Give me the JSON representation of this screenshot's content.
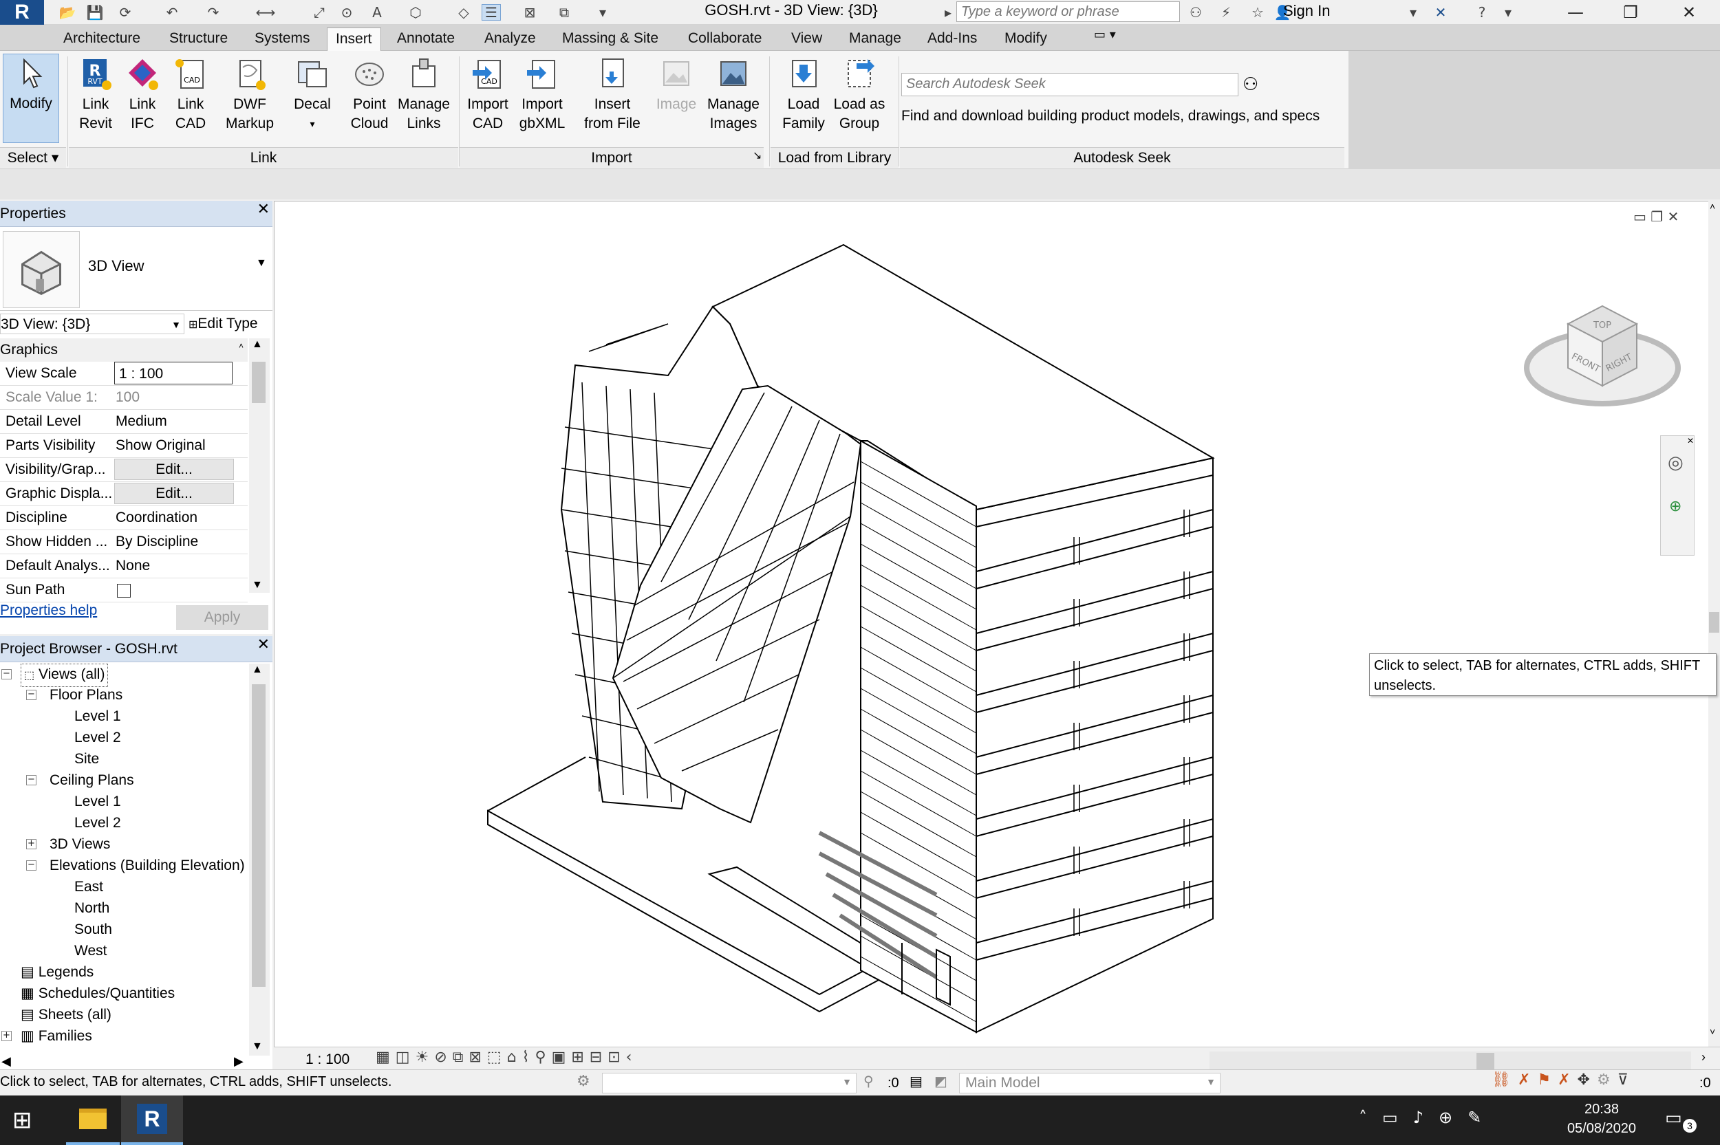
{
  "app": {
    "logo": "R",
    "title": "GOSH.rvt - 3D View: {3D}",
    "search_placeholder": "Type a keyword or phrase",
    "sign_in": "Sign In"
  },
  "tabs": [
    "Architecture",
    "Structure",
    "Systems",
    "Insert",
    "Annotate",
    "Analyze",
    "Massing & Site",
    "Collaborate",
    "View",
    "Manage",
    "Add-Ins",
    "Modify"
  ],
  "active_tab": "Insert",
  "ribbon": {
    "modify": {
      "label": "Modify",
      "panel": "Select"
    },
    "link": {
      "panel": "Link",
      "buttons": [
        {
          "line1": "Link",
          "line2": "Revit"
        },
        {
          "line1": "Link",
          "line2": "IFC"
        },
        {
          "line1": "Link",
          "line2": "CAD"
        },
        {
          "line1": "DWF",
          "line2": "Markup"
        },
        {
          "line1": "Decal",
          "line2": ""
        },
        {
          "line1": "Point",
          "line2": "Cloud"
        },
        {
          "line1": "Manage",
          "line2": "Links"
        }
      ]
    },
    "import": {
      "panel": "Import",
      "buttons": [
        {
          "line1": "Import",
          "line2": "CAD"
        },
        {
          "line1": "Import",
          "line2": "gbXML"
        },
        {
          "line1": "Insert",
          "line2": "from File"
        },
        {
          "line1": "Image",
          "line2": ""
        },
        {
          "line1": "Manage",
          "line2": "Images"
        }
      ]
    },
    "library": {
      "panel": "Load from Library",
      "buttons": [
        {
          "line1": "Load",
          "line2": "Family"
        },
        {
          "line1": "Load as",
          "line2": "Group"
        }
      ]
    },
    "seek": {
      "panel": "Autodesk Seek",
      "placeholder": "Search Autodesk Seek",
      "text": "Find and download building product models, drawings, and specs"
    }
  },
  "properties": {
    "title": "Properties",
    "type_name": "3D View",
    "selector": "3D View: {3D}",
    "edit_type": "Edit Type",
    "section": "Graphics",
    "rows": [
      {
        "k": "View Scale",
        "v": "1 : 100"
      },
      {
        "k": "Scale Value    1:",
        "v": "100"
      },
      {
        "k": "Detail Level",
        "v": "Medium"
      },
      {
        "k": "Parts Visibility",
        "v": "Show Original"
      },
      {
        "k": "Visibility/Grap...",
        "v": "Edit..."
      },
      {
        "k": "Graphic Displa...",
        "v": "Edit..."
      },
      {
        "k": "Discipline",
        "v": "Coordination"
      },
      {
        "k": "Show Hidden ...",
        "v": "By Discipline"
      },
      {
        "k": "Default Analys...",
        "v": "None"
      },
      {
        "k": "Sun Path",
        "v": ""
      }
    ],
    "help": "Properties help",
    "apply": "Apply"
  },
  "browser": {
    "title": "Project Browser - GOSH.rvt",
    "items": [
      "Views (all)",
      "Floor Plans",
      "Level 1",
      "Level 2",
      "Site",
      "Ceiling Plans",
      "Level 1",
      "Level 2",
      "3D Views",
      "Elevations (Building Elevation)",
      "East",
      "North",
      "South",
      "West",
      "Legends",
      "Schedules/Quantities",
      "Sheets (all)",
      "Families"
    ]
  },
  "viewbar": {
    "scale": "1 : 100"
  },
  "status": {
    "text": "Click to select, TAB for alternates, CTRL adds, SHIFT unselects.",
    "worksets": ":0",
    "model": "Main Model",
    "filter": ":0"
  },
  "tooltip": "Click to select, TAB for alternates, CTRL adds, SHIFT unselects.",
  "viewcube": {
    "top": "TOP",
    "front": "FRONT",
    "right": "RIGHT"
  },
  "taskbar": {
    "time": "20:38",
    "date": "05/08/2020",
    "notifications": "3"
  },
  "colors": {
    "revit_blue": "#1a4d8c",
    "panel_header": "#d6e2f1",
    "taskbar": "#1f1f1f"
  }
}
